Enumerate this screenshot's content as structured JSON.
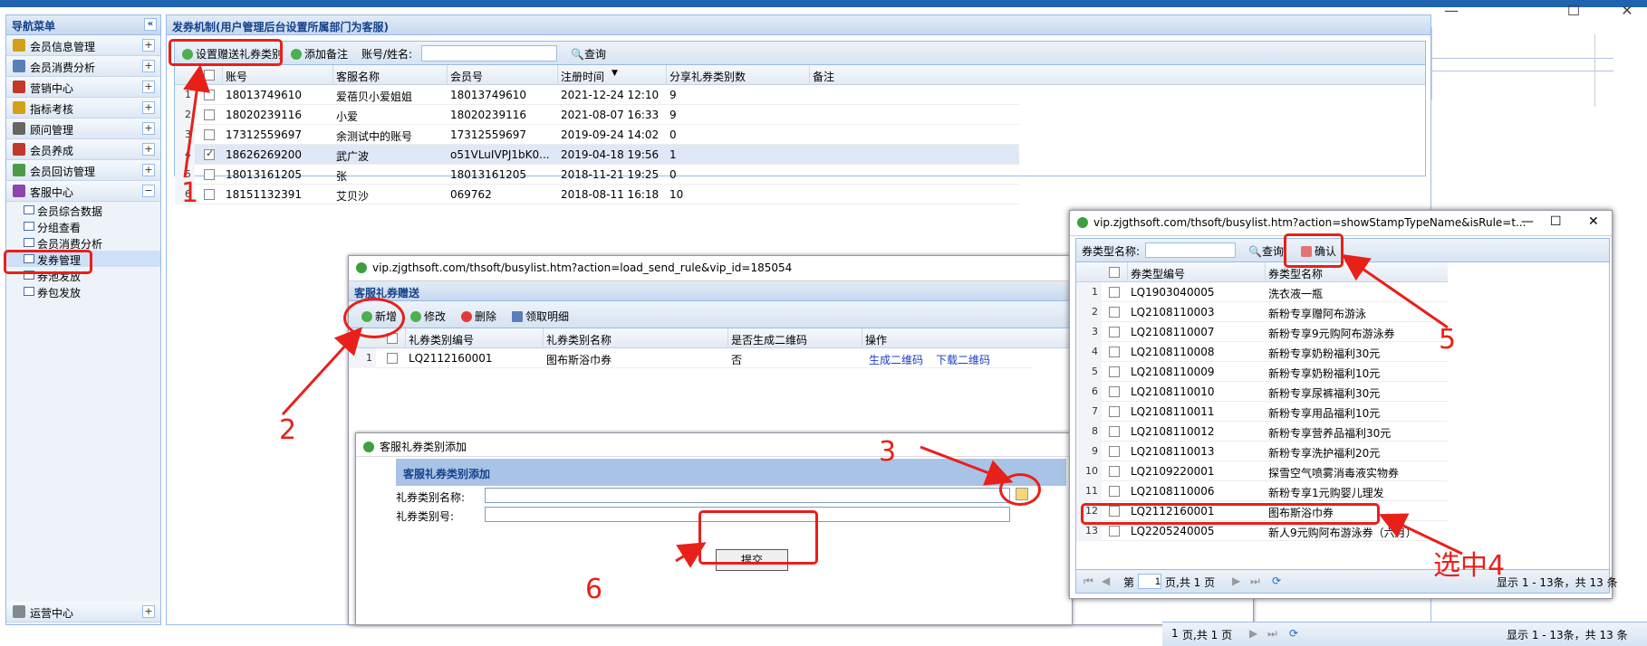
{
  "header": {
    "nav_title": "导航菜单",
    "main_title": "发券机制(用户管理后台设置所属部门为客服)"
  },
  "nav": {
    "items": [
      {
        "label": "会员信息管理",
        "color": "#d4a017"
      },
      {
        "label": "会员消费分析",
        "color": "#5a7fb8"
      },
      {
        "label": "营销中心",
        "color": "#c0392b"
      },
      {
        "label": "指标考核",
        "color": "#d4a017"
      },
      {
        "label": "顾问管理",
        "color": "#666666"
      },
      {
        "label": "会员养成",
        "color": "#c0392b"
      },
      {
        "label": "会员回访管理",
        "color": "#4a9a4a"
      },
      {
        "label": "客服中心",
        "color": "#8e44ad"
      }
    ],
    "sub_items": [
      "会员综合数据",
      "分组查看",
      "会员消费分析",
      "发券管理",
      "券池发放",
      "券包发放"
    ],
    "bottom_item": "运营中心"
  },
  "main": {
    "toolbar": {
      "set_btn": "设置赠送礼券类别",
      "add_note": "添加备注",
      "search_label": "账号/姓名:",
      "search_value": "",
      "query": "查询"
    },
    "columns": [
      "账号",
      "客服名称",
      "会员号",
      "注册时间",
      "分享礼券类别数",
      "备注"
    ],
    "rows": [
      {
        "n": "1",
        "account": "18013749610",
        "name": "爱蓓贝小爱姐姐",
        "member": "18013749610",
        "time": "2021-12-24 12:10",
        "count": "9",
        "checked": false
      },
      {
        "n": "2",
        "account": "18020239116",
        "name": "小爱",
        "member": "18020239116",
        "time": "2021-08-07 16:33",
        "count": "9",
        "checked": false
      },
      {
        "n": "3",
        "account": "17312559697",
        "name": "余测试中的账号",
        "member": "17312559697",
        "time": "2019-09-24 14:02",
        "count": "0",
        "checked": false
      },
      {
        "n": "4",
        "account": "18626269200",
        "name": "武广波",
        "member": "o51VLuIVPJ1bK0...",
        "time": "2019-04-18 19:56",
        "count": "1",
        "checked": true
      },
      {
        "n": "5",
        "account": "18013161205",
        "name": "张",
        "member": "18013161205",
        "time": "2018-11-21 19:25",
        "count": "0",
        "checked": false
      },
      {
        "n": "6",
        "account": "18151132391",
        "name": "艾贝沙",
        "member": "069762",
        "time": "2018-08-11 16:18",
        "count": "10",
        "checked": false
      }
    ]
  },
  "popup1": {
    "url": "vip.zjgthsoft.com/thsoft/busylist.htm?action=load_send_rule&vip_id=185054",
    "panel_title": "客服礼券赠送",
    "toolbar": {
      "add": "新增",
      "edit": "修改",
      "delete": "删除",
      "detail": "领取明细"
    },
    "columns": [
      "礼券类别编号",
      "礼券类别名称",
      "是否生成二维码",
      "操作"
    ],
    "rows": [
      {
        "n": "1",
        "code": "LQ2112160001",
        "name": "图布斯浴巾券",
        "qr": "否",
        "gen": "生成二维码",
        "download": "下载二维码"
      }
    ]
  },
  "popup2": {
    "title": "客服礼券类别添加",
    "panel_title": "客服礼券类别添加",
    "name_label": "礼券类别名称:",
    "code_label": "礼券类别号:",
    "submit": "提交"
  },
  "popup3": {
    "url": "vip.zjgthsoft.com/thsoft/busylist.htm?action=showStampTypeName&isRule=t...",
    "search_label": "券类型名称:",
    "query": "查询",
    "confirm": "确认",
    "columns": [
      "券类型编号",
      "券类型名称"
    ],
    "rows": [
      {
        "n": "1",
        "code": "LQ1903040005",
        "name": "洗衣液一瓶"
      },
      {
        "n": "2",
        "code": "LQ2108110003",
        "name": "新粉专享赠阿布游泳"
      },
      {
        "n": "3",
        "code": "LQ2108110007",
        "name": "新粉专享9元购阿布游泳券"
      },
      {
        "n": "4",
        "code": "LQ2108110008",
        "name": "新粉专享奶粉福利30元"
      },
      {
        "n": "5",
        "code": "LQ2108110009",
        "name": "新粉专享奶粉福利10元"
      },
      {
        "n": "6",
        "code": "LQ2108110010",
        "name": "新粉专享尿裤福利30元"
      },
      {
        "n": "7",
        "code": "LQ2108110011",
        "name": "新粉专享用品福利10元"
      },
      {
        "n": "8",
        "code": "LQ2108110012",
        "name": "新粉专享营养品福利30元"
      },
      {
        "n": "9",
        "code": "LQ2108110013",
        "name": "新粉专享洗护福利20元"
      },
      {
        "n": "10",
        "code": "LQ2109220001",
        "name": "探雪空气喷雾消毒液实物券"
      },
      {
        "n": "11",
        "code": "LQ2108110006",
        "name": "新粉专享1元购婴儿理发"
      },
      {
        "n": "12",
        "code": "LQ2112160001",
        "name": "图布斯浴巾券"
      },
      {
        "n": "13",
        "code": "LQ2205240005",
        "name": "新人9元购阿布游泳券（六月）"
      }
    ],
    "pager": {
      "page_label": "第",
      "page": "1",
      "of": "页,共 1 页",
      "display": "显示 1 - 13条，共 13 条"
    }
  },
  "bg_pager": {
    "of": "页,共 1 页",
    "display": "显示 1 - 13条，共 13 条",
    "page": "1"
  },
  "annotations": [
    "1",
    "2",
    "3",
    "选中4",
    "5",
    "6"
  ]
}
